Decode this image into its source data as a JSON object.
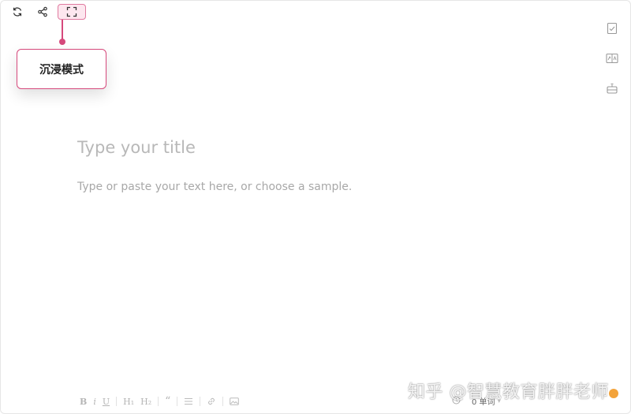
{
  "toolbar": {
    "refresh_icon": "refresh-icon",
    "share_icon": "share-icon",
    "fullscreen_icon": "fullscreen-icon"
  },
  "callout": {
    "label": "沉浸模式",
    "accent_color": "#d6497c"
  },
  "side": {
    "icons": [
      "checklist-icon",
      "compare-icon",
      "robot-icon"
    ]
  },
  "editor": {
    "title_placeholder": "Type your title",
    "body_placeholder": "Type or paste your text here, or choose a sample."
  },
  "format_bar": {
    "bold": "B",
    "italic": "i",
    "underline": "U",
    "h1": "H₁",
    "h2": "H₂",
    "quote": "“"
  },
  "status": {
    "word_count": "0 单词"
  },
  "watermark": "知乎 @智慧教育胖胖老师"
}
